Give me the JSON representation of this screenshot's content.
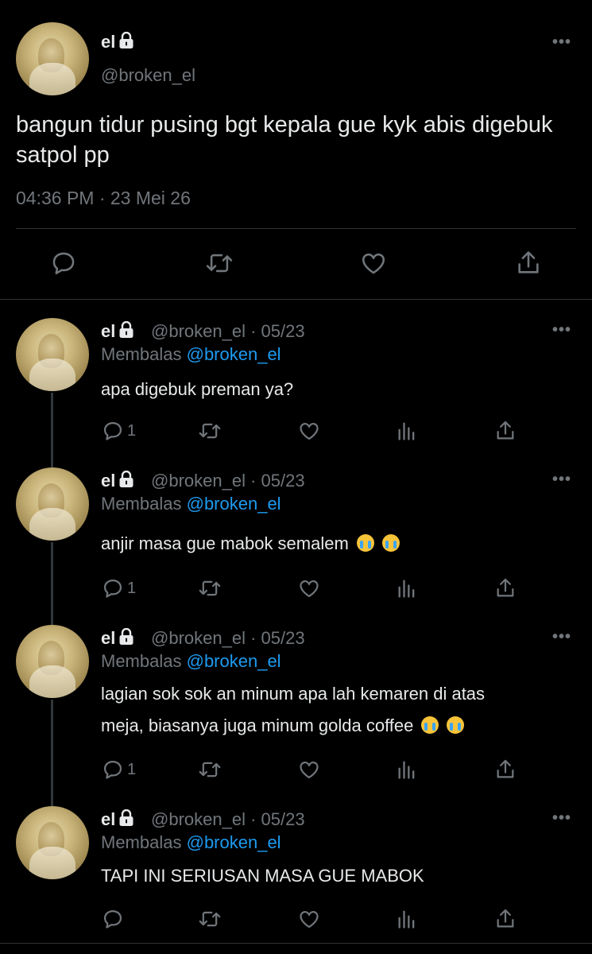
{
  "main_tweet": {
    "display_name": "el",
    "handle": "@broken_el",
    "text": "bangun tidur pusing bgt kepala gue kyk abis digebuk satpol pp",
    "timestamp": "04:36 PM · 23 Mei 26"
  },
  "replies": [
    {
      "display_name": "el",
      "handle_date": "@broken_el · 05/23",
      "replying_label": "Membalas",
      "replying_to": "@broken_el",
      "text": "apa digebuk preman ya?",
      "reply_count": "1"
    },
    {
      "display_name": "el",
      "handle_date": "@broken_el · 05/23",
      "replying_label": "Membalas",
      "replying_to": "@broken_el",
      "text": "anjir masa gue mabok semalem",
      "emoji_count": 2,
      "reply_count": "1"
    },
    {
      "display_name": "el",
      "handle_date": "@broken_el · 05/23",
      "replying_label": "Membalas",
      "replying_to": "@broken_el",
      "text_line1": "lagian sok sok an minum apa lah kemaren di atas",
      "text_line2": "meja, biasanya juga minum golda coffee",
      "emoji_count": 2,
      "reply_count": "1"
    },
    {
      "display_name": "el",
      "handle_date": "@broken_el · 05/23",
      "replying_label": "Membalas",
      "replying_to": "@broken_el",
      "text": "TAPI INI SERIUSAN MASA GUE MABOK",
      "reply_count": ""
    }
  ],
  "icons": {
    "lock": "lock-icon",
    "more": "more-icon",
    "reply": "reply-icon",
    "retweet": "retweet-icon",
    "like": "like-icon",
    "views": "views-icon",
    "share": "share-icon",
    "emoji": "loudly-crying-face-emoji"
  },
  "colors": {
    "background": "#000000",
    "text": "#e7e9ea",
    "muted": "#71767b",
    "link": "#1d9bf0",
    "divider": "#2f3336"
  }
}
